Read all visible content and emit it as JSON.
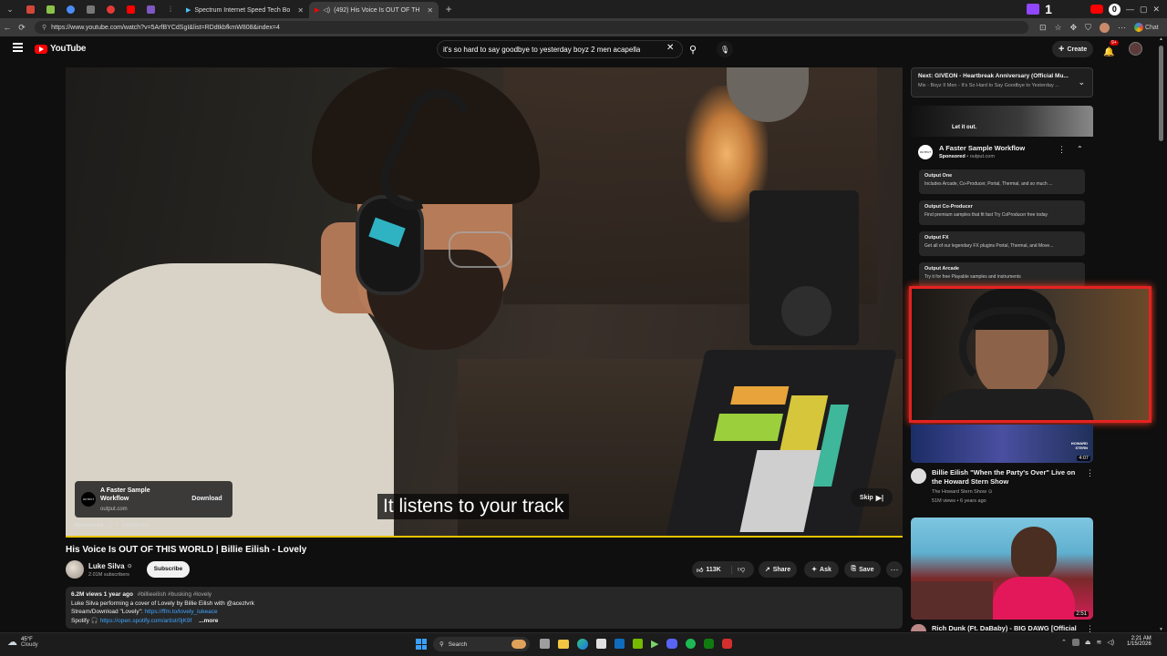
{
  "browser": {
    "tabs": [
      {
        "label": "Spectrum Internet Speed Tech Bo"
      },
      {
        "label": "(492) His Voice Is OUT OF TH"
      }
    ],
    "url": "https://www.youtube.com/watch?v=5ArfBYCdSgI&list=RDdtkbfkmW808&index=4"
  },
  "header": {
    "logo": "YouTube",
    "search_value": "it's so hard to say goodbye to yesterday boyz 2 men acapella",
    "create_label": "Create",
    "notif_count": "9+"
  },
  "player": {
    "caption": "It listens to your track",
    "ad_title": "A Faster Sample Workflow",
    "ad_domain": "output.com",
    "ad_cta": "Download",
    "sponsored": "Sponsored",
    "sponsored_domain": "output.com",
    "skip": "Skip",
    "brand": "OUTPUT"
  },
  "video": {
    "title": "His Voice Is OUT OF THIS WORLD | Billie Eilish - Lovely",
    "channel": "Luke Silva",
    "subs": "2.01M subscribers",
    "subscribe": "Subscribe",
    "likes": "113K",
    "share": "Share",
    "ask": "Ask",
    "save": "Save",
    "meta": "6.2M views  1 year ago",
    "tags": "#billieeilish #busking #lovely",
    "desc1": "Luke Silva performing a cover of Lovely by Billie Eilish with @acezlvrk",
    "desc2_prefix": "Stream/Download \"Lovely\": ",
    "desc2_link": "https://ffm.to/lovely_lukeace",
    "desc3_prefix": "Spotify 🎧 ",
    "desc3_link": "https://open.spotify.com/artist/0jK9f",
    "more": "...more"
  },
  "sidebar": {
    "next_label": "Next:",
    "next_title": "GIVĒON - Heartbreak Anniversary (Official Mu...",
    "next_sub": "Mix - Boyz II Men - It's So Hard to Say Goodbye to Yesterday ...",
    "banner_text": "Let it out.",
    "ad_title": "A Faster Sample Workflow",
    "ad_sponsored": "Sponsored",
    "ad_domain": "output.com",
    "ad_items": [
      {
        "title": "Output One",
        "desc": "Includes Arcade, Co-Producer, Portal, Thermal, and so much ..."
      },
      {
        "title": "Output Co-Producer",
        "desc": "Find premium samples that fit fast Try CoProducer free today"
      },
      {
        "title": "Output FX",
        "desc": "Get all of our legendary FX plugins Portal, Thermal, and Move..."
      },
      {
        "title": "Output Arcade",
        "desc": "Try it for free Playable samples and instruments"
      }
    ],
    "videos": [
      {
        "title": "Billie Eilish \"When the Party's Over\" Live on the Howard Stern Show",
        "channel": "The Howard Stern Show",
        "meta": "51M views • 6 years ago",
        "duration": "4:07",
        "thumb_text": "HOWARD STERN"
      },
      {
        "title": "Rich Dunk (Ft. DaBaby) - BIG DAWG [Official",
        "duration": "2:51"
      }
    ]
  },
  "taskbar": {
    "weather_temp": "45°F",
    "weather_desc": "Cloudy",
    "search": "Search",
    "time": "2:21 AM",
    "date": "1/15/2026"
  },
  "colors": {
    "background": "#0f0f0f",
    "youtube_red": "#ff0000",
    "progress": "#e6c200",
    "cam_border": "#e52222"
  }
}
